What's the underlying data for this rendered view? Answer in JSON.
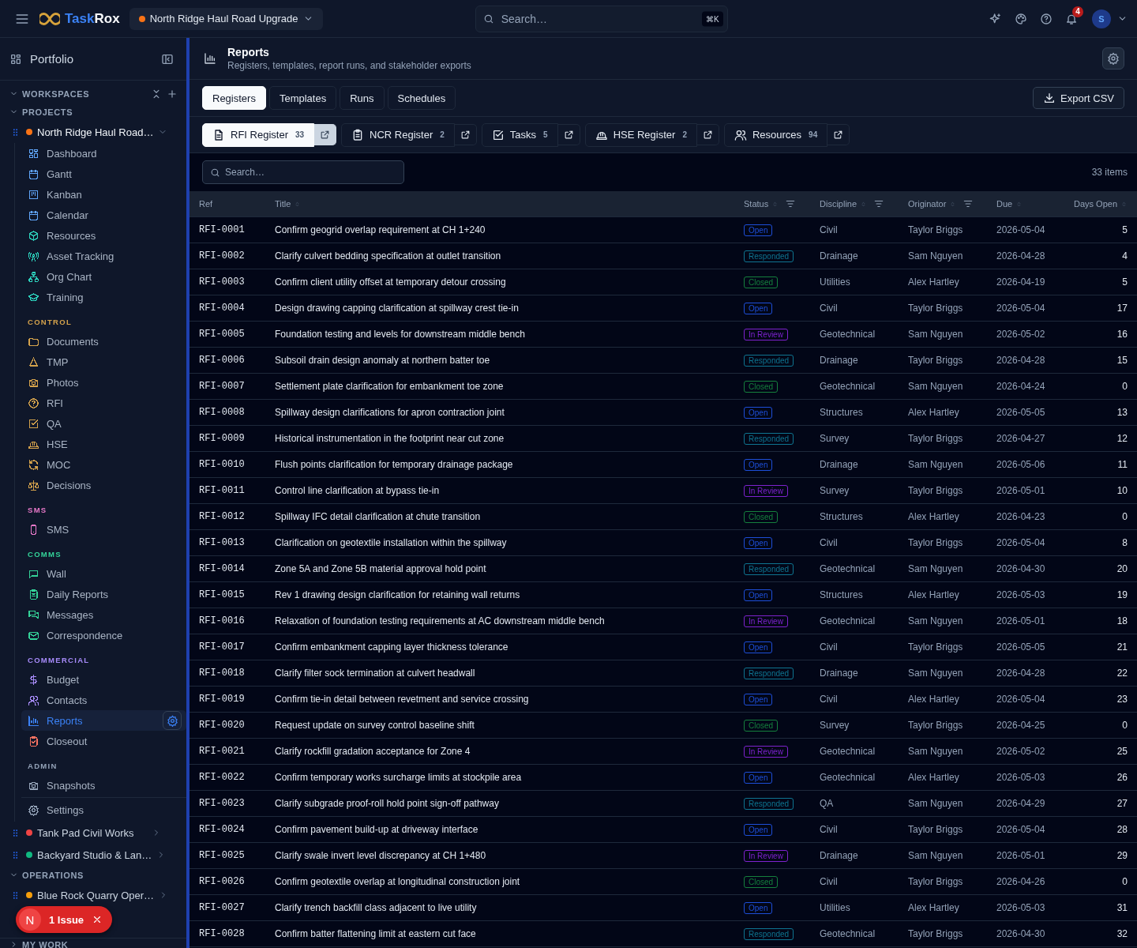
{
  "top_bar": {
    "brand": [
      "Task",
      "Rox"
    ],
    "project_selector": {
      "label": "North Ridge Haul Road Upgrade",
      "color": "#f97316"
    },
    "search": {
      "placeholder": "Search…",
      "shortcut": "⌘K"
    },
    "notifications": {
      "count": "4"
    },
    "avatar": {
      "initial": "S"
    }
  },
  "sidebar": {
    "title": "Portfolio",
    "workspaces": {
      "label": "WORKSPACES",
      "expanded": true
    },
    "projects_section": {
      "label": "PROJECTS",
      "expanded": true
    },
    "projects": [
      {
        "name": "North Ridge Haul Road…",
        "color": "#f97316",
        "expanded": true,
        "groups": [
          {
            "color": "#60a5fa",
            "items": [
              {
                "label": "Dashboard",
                "selected": false
              },
              {
                "label": "Gantt",
                "selected": false
              },
              {
                "label": "Kanban",
                "selected": false
              },
              {
                "label": "Calendar",
                "selected": false
              }
            ]
          },
          {
            "color": "#2dd4bf",
            "items": [
              {
                "label": "Resources",
                "selected": false
              },
              {
                "label": "Asset Tracking",
                "selected": false
              },
              {
                "label": "Org Chart",
                "selected": false
              },
              {
                "label": "Training",
                "selected": false
              }
            ]
          },
          {
            "title": "CONTROL",
            "color": "#d4a24c",
            "items": [
              {
                "label": "Documents",
                "selected": false
              },
              {
                "label": "TMP",
                "selected": false
              },
              {
                "label": "Photos",
                "selected": false
              },
              {
                "label": "RFI",
                "selected": false
              },
              {
                "label": "QA",
                "selected": false
              },
              {
                "label": "HSE",
                "selected": false
              },
              {
                "label": "MOC",
                "selected": false
              },
              {
                "label": "Decisions",
                "selected": false
              }
            ]
          },
          {
            "title": "SMS",
            "color": "#e879c9",
            "items": [
              {
                "label": "SMS",
                "selected": false
              }
            ]
          },
          {
            "title": "COMMS",
            "color": "#34d399",
            "items": [
              {
                "label": "Wall",
                "selected": false
              },
              {
                "label": "Daily Reports",
                "selected": false
              },
              {
                "label": "Messages",
                "selected": false
              },
              {
                "label": "Correspondence",
                "selected": false
              }
            ]
          },
          {
            "title": "COMMERCIAL",
            "color": "#a78bfa",
            "items": [
              {
                "label": "Budget",
                "selected": false
              },
              {
                "label": "Contacts",
                "selected": false
              },
              {
                "label": "Reports",
                "selected": true
              },
              {
                "label": "Closeout",
                "selected": false,
                "color": "#f97362"
              }
            ]
          },
          {
            "title": "ADMIN",
            "color": "#94a3b8",
            "items": [
              {
                "label": "Snapshots",
                "selected": false
              },
              {
                "label": "Settings",
                "selected": false
              }
            ]
          }
        ]
      },
      {
        "name": "Tank Pad Civil Works",
        "color": "#ef4444",
        "expanded": false
      },
      {
        "name": "Backyard Studio & Lan…",
        "color": "#10b981",
        "expanded": false
      }
    ],
    "operations_section": {
      "label": "OPERATIONS",
      "expanded": true
    },
    "operations": [
      {
        "name": "Blue Rock Quarry Oper…",
        "color": "#f59e0b",
        "expanded": false
      }
    ],
    "my_work_section": {
      "label": "MY WORK",
      "expanded": false
    }
  },
  "issue_toast": {
    "avatar": "N",
    "label": "1 Issue"
  },
  "page": {
    "title": "Reports",
    "subtitle": "Registers, templates, report runs, and stakeholder exports"
  },
  "tabs": [
    {
      "label": "Registers",
      "selected": true
    },
    {
      "label": "Templates",
      "selected": false
    },
    {
      "label": "Runs",
      "selected": false
    },
    {
      "label": "Schedules",
      "selected": false
    }
  ],
  "export_button": "Export CSV",
  "registers": [
    {
      "label": "RFI Register",
      "count": "33",
      "selected": true
    },
    {
      "label": "NCR Register",
      "count": "2",
      "selected": false
    },
    {
      "label": "Tasks",
      "count": "5",
      "selected": false
    },
    {
      "label": "HSE Register",
      "count": "2",
      "selected": false
    },
    {
      "label": "Resources",
      "count": "94",
      "selected": false
    }
  ],
  "search": {
    "placeholder": "Search…"
  },
  "item_count": "33 items",
  "table": {
    "columns": [
      {
        "label": "Ref",
        "sortable": false,
        "filter": false
      },
      {
        "label": "Title",
        "sortable": true,
        "filter": false
      },
      {
        "label": "Status",
        "sortable": true,
        "filter": true
      },
      {
        "label": "Discipline",
        "sortable": true,
        "filter": true
      },
      {
        "label": "Originator",
        "sortable": true,
        "filter": true
      },
      {
        "label": "Due",
        "sortable": true,
        "filter": false
      },
      {
        "label": "Days Open",
        "sortable": true,
        "filter": false
      }
    ],
    "rows": [
      {
        "ref": "RFI-0001",
        "title": "Confirm geogrid overlap requirement at CH 1+240",
        "status": {
          "label": "Open",
          "color": "#1d4ed8"
        },
        "discipline": "Civil",
        "originator": "Taylor Briggs",
        "due": "2026-05-04",
        "days_open": "5"
      },
      {
        "ref": "RFI-0002",
        "title": "Clarify culvert bedding specification at outlet transition",
        "status": {
          "label": "Responded",
          "color": "#0e7490"
        },
        "discipline": "Drainage",
        "originator": "Sam Nguyen",
        "due": "2026-04-28",
        "days_open": "4"
      },
      {
        "ref": "RFI-0003",
        "title": "Confirm client utility offset at temporary detour crossing",
        "status": {
          "label": "Closed",
          "color": "#15803d"
        },
        "discipline": "Utilities",
        "originator": "Alex Hartley",
        "due": "2026-04-19",
        "days_open": "5"
      },
      {
        "ref": "RFI-0004",
        "title": "Design drawing capping clarification at spillway crest tie-in",
        "status": {
          "label": "Open",
          "color": "#1d4ed8"
        },
        "discipline": "Civil",
        "originator": "Taylor Briggs",
        "due": "2026-05-04",
        "days_open": "17"
      },
      {
        "ref": "RFI-0005",
        "title": "Foundation testing and levels for downstream middle bench",
        "status": {
          "label": "In Review",
          "color": "#7e22ce"
        },
        "discipline": "Geotechnical",
        "originator": "Sam Nguyen",
        "due": "2026-05-02",
        "days_open": "16"
      },
      {
        "ref": "RFI-0006",
        "title": "Subsoil drain design anomaly at northern batter toe",
        "status": {
          "label": "Responded",
          "color": "#0e7490"
        },
        "discipline": "Drainage",
        "originator": "Taylor Briggs",
        "due": "2026-04-28",
        "days_open": "15"
      },
      {
        "ref": "RFI-0007",
        "title": "Settlement plate clarification for embankment toe zone",
        "status": {
          "label": "Closed",
          "color": "#15803d"
        },
        "discipline": "Geotechnical",
        "originator": "Sam Nguyen",
        "due": "2026-04-24",
        "days_open": "0"
      },
      {
        "ref": "RFI-0008",
        "title": "Spillway design clarifications for apron contraction joint",
        "status": {
          "label": "Open",
          "color": "#1d4ed8"
        },
        "discipline": "Structures",
        "originator": "Alex Hartley",
        "due": "2026-05-05",
        "days_open": "13"
      },
      {
        "ref": "RFI-0009",
        "title": "Historical instrumentation in the footprint near cut zone",
        "status": {
          "label": "Responded",
          "color": "#0e7490"
        },
        "discipline": "Survey",
        "originator": "Taylor Briggs",
        "due": "2026-04-27",
        "days_open": "12"
      },
      {
        "ref": "RFI-0010",
        "title": "Flush points clarification for temporary drainage package",
        "status": {
          "label": "Open",
          "color": "#1d4ed8"
        },
        "discipline": "Drainage",
        "originator": "Sam Nguyen",
        "due": "2026-05-06",
        "days_open": "11"
      },
      {
        "ref": "RFI-0011",
        "title": "Control line clarification at bypass tie-in",
        "status": {
          "label": "In Review",
          "color": "#7e22ce"
        },
        "discipline": "Survey",
        "originator": "Taylor Briggs",
        "due": "2026-05-01",
        "days_open": "10"
      },
      {
        "ref": "RFI-0012",
        "title": "Spillway IFC detail clarification at chute transition",
        "status": {
          "label": "Closed",
          "color": "#15803d"
        },
        "discipline": "Structures",
        "originator": "Alex Hartley",
        "due": "2026-04-23",
        "days_open": "0"
      },
      {
        "ref": "RFI-0013",
        "title": "Clarification on geotextile installation within the spillway",
        "status": {
          "label": "Open",
          "color": "#1d4ed8"
        },
        "discipline": "Civil",
        "originator": "Taylor Briggs",
        "due": "2026-05-04",
        "days_open": "8"
      },
      {
        "ref": "RFI-0014",
        "title": "Zone 5A and Zone 5B material approval hold point",
        "status": {
          "label": "Responded",
          "color": "#0e7490"
        },
        "discipline": "Geotechnical",
        "originator": "Sam Nguyen",
        "due": "2026-04-30",
        "days_open": "20"
      },
      {
        "ref": "RFI-0015",
        "title": "Rev 1 drawing design clarification for retaining wall returns",
        "status": {
          "label": "Open",
          "color": "#1d4ed8"
        },
        "discipline": "Structures",
        "originator": "Alex Hartley",
        "due": "2026-05-03",
        "days_open": "19"
      },
      {
        "ref": "RFI-0016",
        "title": "Relaxation of foundation testing requirements at AC downstream middle bench",
        "status": {
          "label": "In Review",
          "color": "#7e22ce"
        },
        "discipline": "Geotechnical",
        "originator": "Sam Nguyen",
        "due": "2026-05-01",
        "days_open": "18"
      },
      {
        "ref": "RFI-0017",
        "title": "Confirm embankment capping layer thickness tolerance",
        "status": {
          "label": "Open",
          "color": "#1d4ed8"
        },
        "discipline": "Civil",
        "originator": "Taylor Briggs",
        "due": "2026-05-05",
        "days_open": "21"
      },
      {
        "ref": "RFI-0018",
        "title": "Clarify filter sock termination at culvert headwall",
        "status": {
          "label": "Responded",
          "color": "#0e7490"
        },
        "discipline": "Drainage",
        "originator": "Sam Nguyen",
        "due": "2026-04-28",
        "days_open": "22"
      },
      {
        "ref": "RFI-0019",
        "title": "Confirm tie-in detail between revetment and service crossing",
        "status": {
          "label": "Open",
          "color": "#1d4ed8"
        },
        "discipline": "Civil",
        "originator": "Alex Hartley",
        "due": "2026-05-04",
        "days_open": "23"
      },
      {
        "ref": "RFI-0020",
        "title": "Request update on survey control baseline shift",
        "status": {
          "label": "Closed",
          "color": "#15803d"
        },
        "discipline": "Survey",
        "originator": "Taylor Briggs",
        "due": "2026-04-25",
        "days_open": "0"
      },
      {
        "ref": "RFI-0021",
        "title": "Clarify rockfill gradation acceptance for Zone 4",
        "status": {
          "label": "In Review",
          "color": "#7e22ce"
        },
        "discipline": "Geotechnical",
        "originator": "Sam Nguyen",
        "due": "2026-05-02",
        "days_open": "25"
      },
      {
        "ref": "RFI-0022",
        "title": "Confirm temporary works surcharge limits at stockpile area",
        "status": {
          "label": "Open",
          "color": "#1d4ed8"
        },
        "discipline": "Geotechnical",
        "originator": "Alex Hartley",
        "due": "2026-05-03",
        "days_open": "26"
      },
      {
        "ref": "RFI-0023",
        "title": "Clarify subgrade proof-roll hold point sign-off pathway",
        "status": {
          "label": "Responded",
          "color": "#0e7490"
        },
        "discipline": "QA",
        "originator": "Sam Nguyen",
        "due": "2026-04-29",
        "days_open": "27"
      },
      {
        "ref": "RFI-0024",
        "title": "Confirm pavement build-up at driveway interface",
        "status": {
          "label": "Open",
          "color": "#1d4ed8"
        },
        "discipline": "Civil",
        "originator": "Taylor Briggs",
        "due": "2026-05-04",
        "days_open": "28"
      },
      {
        "ref": "RFI-0025",
        "title": "Clarify swale invert level discrepancy at CH 1+480",
        "status": {
          "label": "In Review",
          "color": "#7e22ce"
        },
        "discipline": "Drainage",
        "originator": "Sam Nguyen",
        "due": "2026-05-01",
        "days_open": "29"
      },
      {
        "ref": "RFI-0026",
        "title": "Confirm geotextile overlap at longitudinal construction joint",
        "status": {
          "label": "Closed",
          "color": "#15803d"
        },
        "discipline": "Civil",
        "originator": "Taylor Briggs",
        "due": "2026-04-26",
        "days_open": "0"
      },
      {
        "ref": "RFI-0027",
        "title": "Clarify trench backfill class adjacent to live utility",
        "status": {
          "label": "Open",
          "color": "#1d4ed8"
        },
        "discipline": "Utilities",
        "originator": "Alex Hartley",
        "due": "2026-05-03",
        "days_open": "31"
      },
      {
        "ref": "RFI-0028",
        "title": "Confirm batter flattening limit at eastern cut face",
        "status": {
          "label": "Responded",
          "color": "#0e7490"
        },
        "discipline": "Geotechnical",
        "originator": "Taylor Briggs",
        "due": "2026-04-30",
        "days_open": "32"
      }
    ]
  }
}
